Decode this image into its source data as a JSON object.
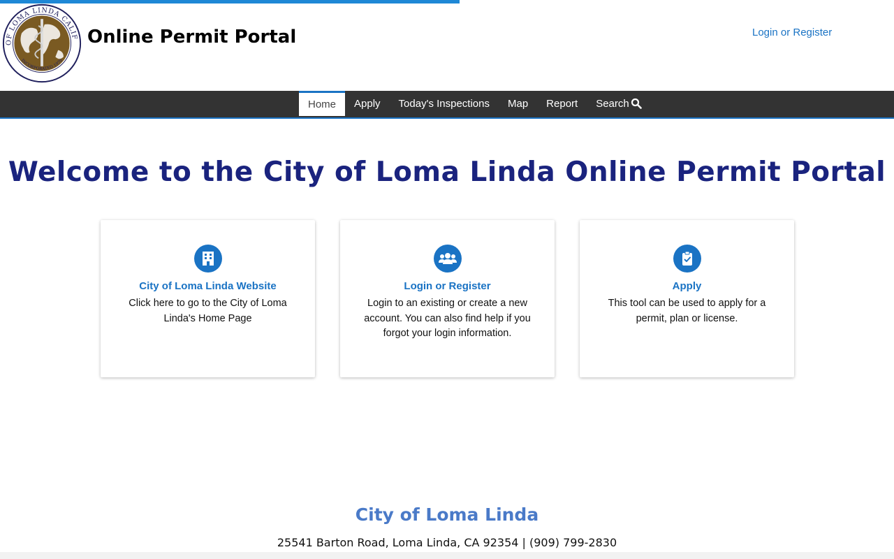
{
  "page_load_progress": 0.51,
  "header": {
    "seal_name": "city-seal",
    "seal_text_top": "CITY OF LOMA LINDA CALIFORNIA",
    "seal_text_bottom": "INCORPORATED 1970",
    "site_title": "Online Permit Portal",
    "login_link": "Login or Register"
  },
  "nav": {
    "items": [
      {
        "label": "Home",
        "active": true
      },
      {
        "label": "Apply"
      },
      {
        "label": "Today's Inspections"
      },
      {
        "label": "Map"
      },
      {
        "label": "Report"
      },
      {
        "label": "Search",
        "icon": "search-icon"
      }
    ]
  },
  "main": {
    "welcome": "Welcome to the City of Loma Linda Online Permit Portal",
    "cards": [
      {
        "icon": "building-icon",
        "title": "City of Loma Linda Website",
        "description": "Click here to go to the City of Loma Linda's Home Page"
      },
      {
        "icon": "users-icon",
        "title": "Login or Register",
        "description": "Login to an existing or create a new account. You can also find help if you forgot your login information."
      },
      {
        "icon": "clipboard-check-icon",
        "title": "Apply",
        "description": "This tool can be used to apply for a permit, plan or license."
      }
    ]
  },
  "footer": {
    "name": "City of Loma Linda",
    "address": "25541 Barton Road, Loma Linda, CA 92354 | (909) 799-2830"
  },
  "colors": {
    "accent": "#1a73c4",
    "navbar": "#333333",
    "welcome": "#1a237e",
    "footer_name": "#4a7ac8"
  }
}
